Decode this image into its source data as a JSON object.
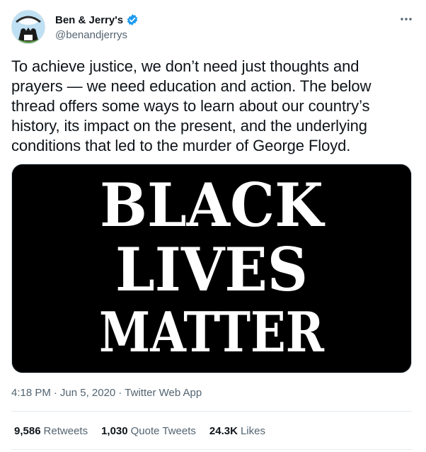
{
  "account": {
    "display_name": "Ben & Jerry's",
    "handle": "@benandjerrys",
    "verified": true,
    "avatar_icon": "ben-and-jerrys-logo-icon",
    "verified_icon": "verified-badge-icon"
  },
  "more_icon": "more-options-icon",
  "tweet": {
    "lines": [
      "To achieve justice, we don’t need just thoughts and",
      "prayers — we need education and action. The below",
      "thread offers some ways to learn about our country’s",
      "history, its impact on the present, and the underlying",
      "conditions that led to the murder of George Floyd."
    ]
  },
  "media": {
    "lines": [
      "BLACK",
      "LIVES",
      "MATTER"
    ],
    "background": "#000000",
    "text_color": "#ffffff"
  },
  "meta": {
    "time": "4:18 PM",
    "separator": "·",
    "date": "Jun 5, 2020",
    "source": "Twitter Web App"
  },
  "stats": {
    "retweets_count": "9,586",
    "retweets_label": "Retweets",
    "quote_tweets_count": "1,030",
    "quote_tweets_label": "Quote Tweets",
    "likes_count": "24.3K",
    "likes_label": "Likes"
  },
  "colors": {
    "accent": "#1d9bf0",
    "secondary_text": "#536471",
    "primary_text": "#0f1419",
    "divider": "#e7ecf0"
  }
}
